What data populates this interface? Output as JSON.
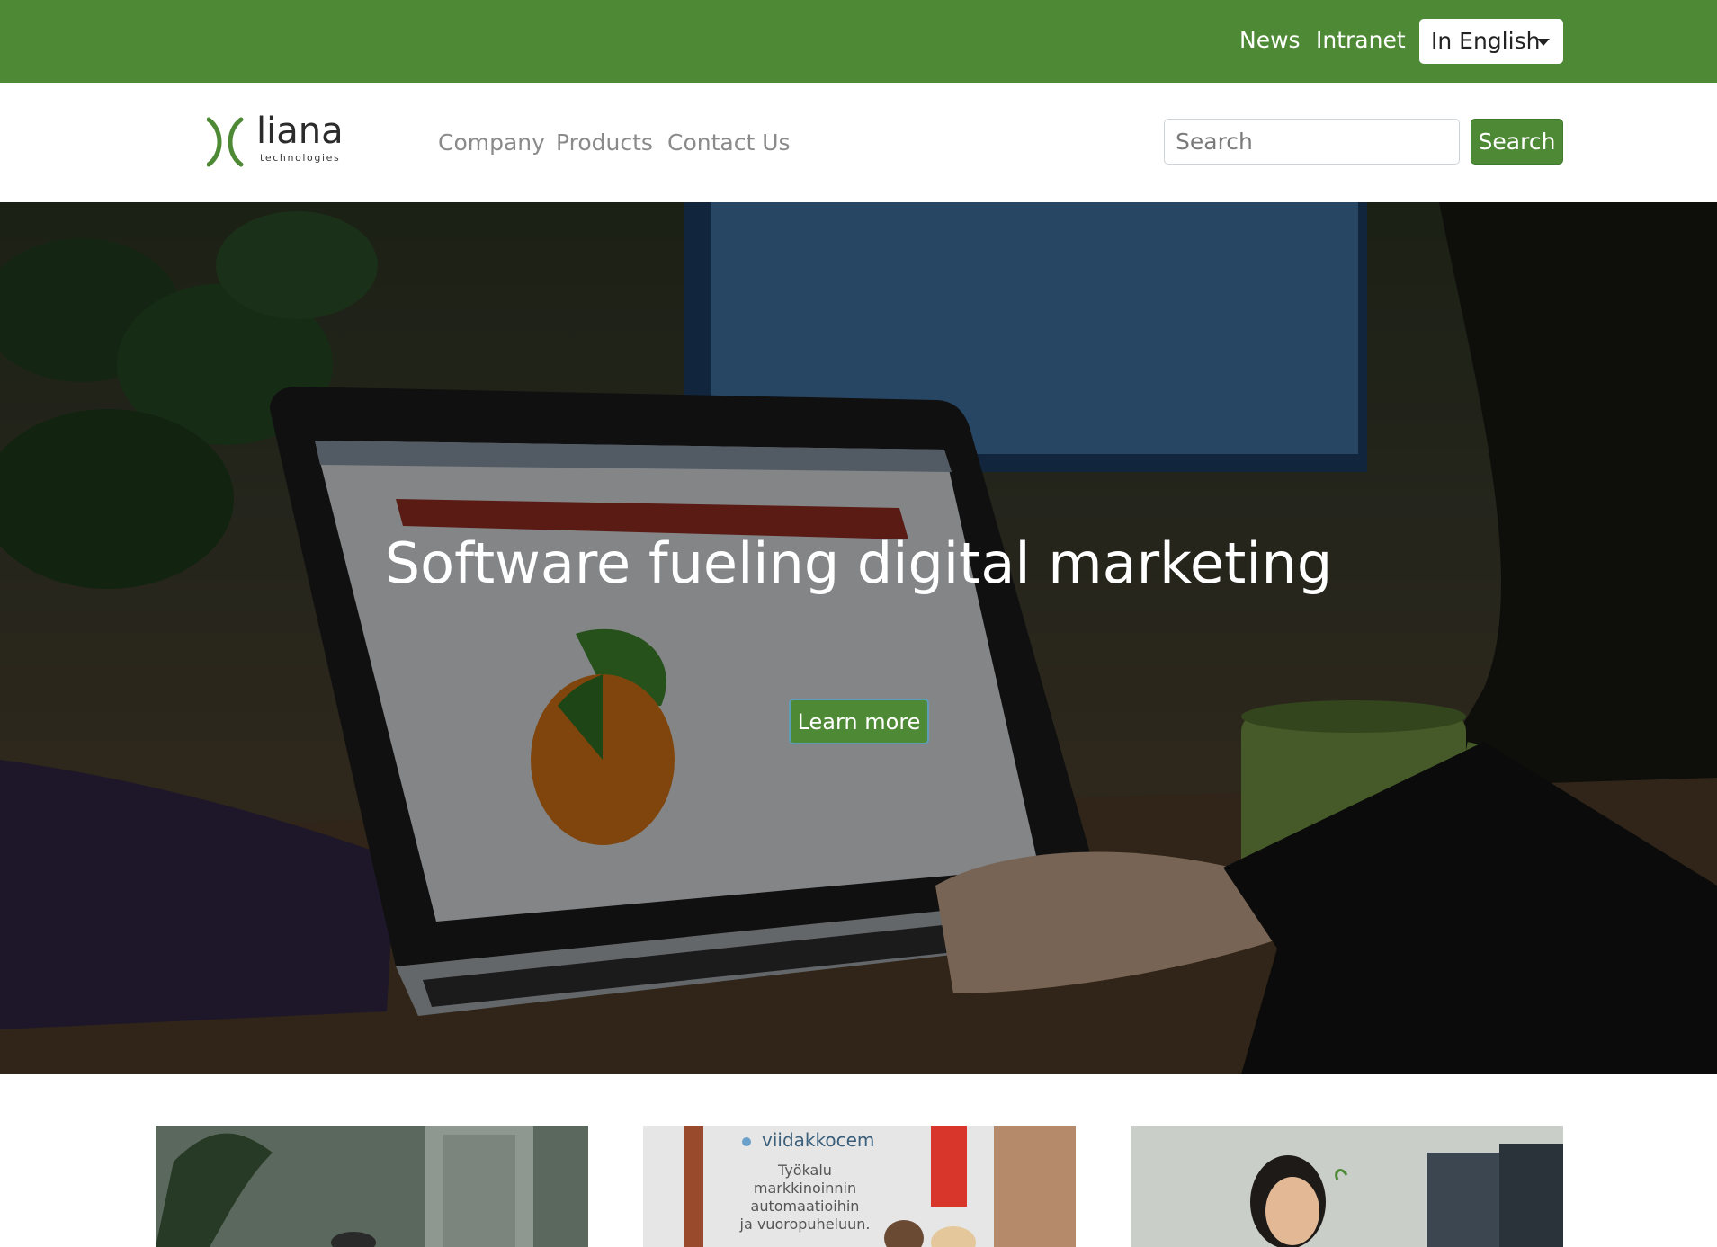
{
  "topbar": {
    "news": "News",
    "intranet": "Intranet",
    "language": "In English"
  },
  "nav": {
    "logo_word": "liana",
    "logo_sub": "technologies",
    "items": [
      {
        "label": "Company"
      },
      {
        "label": "Products"
      },
      {
        "label": "Contact Us"
      }
    ],
    "search_placeholder": "Search",
    "search_button": "Search"
  },
  "hero": {
    "title": "Software fueling digital marketing",
    "cta": "Learn more"
  },
  "cards": [
    {
      "name": "office-photo"
    },
    {
      "name": "viidakko-cem-photo",
      "brand": "viidakkocem",
      "caption": [
        "Työkalu",
        "markkinoinnin",
        "automaatioihin",
        "ja vuoropuheluun."
      ]
    },
    {
      "name": "team-member-photo"
    }
  ],
  "colors": {
    "brand_green": "#4e8a35",
    "nav_gray": "#8a8a8a"
  }
}
